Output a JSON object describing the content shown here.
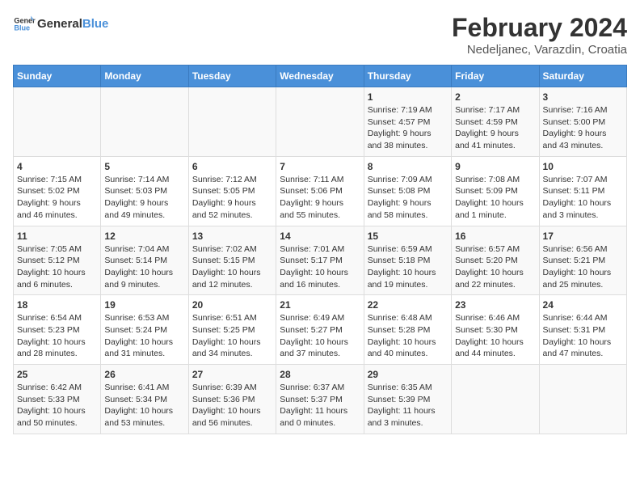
{
  "header": {
    "logo_line1": "General",
    "logo_line2": "Blue",
    "main_title": "February 2024",
    "subtitle": "Nedeljanec, Varazdin, Croatia"
  },
  "weekdays": [
    "Sunday",
    "Monday",
    "Tuesday",
    "Wednesday",
    "Thursday",
    "Friday",
    "Saturday"
  ],
  "weeks": [
    [
      {
        "day": "",
        "info": ""
      },
      {
        "day": "",
        "info": ""
      },
      {
        "day": "",
        "info": ""
      },
      {
        "day": "",
        "info": ""
      },
      {
        "day": "1",
        "info": "Sunrise: 7:19 AM\nSunset: 4:57 PM\nDaylight: 9 hours\nand 38 minutes."
      },
      {
        "day": "2",
        "info": "Sunrise: 7:17 AM\nSunset: 4:59 PM\nDaylight: 9 hours\nand 41 minutes."
      },
      {
        "day": "3",
        "info": "Sunrise: 7:16 AM\nSunset: 5:00 PM\nDaylight: 9 hours\nand 43 minutes."
      }
    ],
    [
      {
        "day": "4",
        "info": "Sunrise: 7:15 AM\nSunset: 5:02 PM\nDaylight: 9 hours\nand 46 minutes."
      },
      {
        "day": "5",
        "info": "Sunrise: 7:14 AM\nSunset: 5:03 PM\nDaylight: 9 hours\nand 49 minutes."
      },
      {
        "day": "6",
        "info": "Sunrise: 7:12 AM\nSunset: 5:05 PM\nDaylight: 9 hours\nand 52 minutes."
      },
      {
        "day": "7",
        "info": "Sunrise: 7:11 AM\nSunset: 5:06 PM\nDaylight: 9 hours\nand 55 minutes."
      },
      {
        "day": "8",
        "info": "Sunrise: 7:09 AM\nSunset: 5:08 PM\nDaylight: 9 hours\nand 58 minutes."
      },
      {
        "day": "9",
        "info": "Sunrise: 7:08 AM\nSunset: 5:09 PM\nDaylight: 10 hours\nand 1 minute."
      },
      {
        "day": "10",
        "info": "Sunrise: 7:07 AM\nSunset: 5:11 PM\nDaylight: 10 hours\nand 3 minutes."
      }
    ],
    [
      {
        "day": "11",
        "info": "Sunrise: 7:05 AM\nSunset: 5:12 PM\nDaylight: 10 hours\nand 6 minutes."
      },
      {
        "day": "12",
        "info": "Sunrise: 7:04 AM\nSunset: 5:14 PM\nDaylight: 10 hours\nand 9 minutes."
      },
      {
        "day": "13",
        "info": "Sunrise: 7:02 AM\nSunset: 5:15 PM\nDaylight: 10 hours\nand 12 minutes."
      },
      {
        "day": "14",
        "info": "Sunrise: 7:01 AM\nSunset: 5:17 PM\nDaylight: 10 hours\nand 16 minutes."
      },
      {
        "day": "15",
        "info": "Sunrise: 6:59 AM\nSunset: 5:18 PM\nDaylight: 10 hours\nand 19 minutes."
      },
      {
        "day": "16",
        "info": "Sunrise: 6:57 AM\nSunset: 5:20 PM\nDaylight: 10 hours\nand 22 minutes."
      },
      {
        "day": "17",
        "info": "Sunrise: 6:56 AM\nSunset: 5:21 PM\nDaylight: 10 hours\nand 25 minutes."
      }
    ],
    [
      {
        "day": "18",
        "info": "Sunrise: 6:54 AM\nSunset: 5:23 PM\nDaylight: 10 hours\nand 28 minutes."
      },
      {
        "day": "19",
        "info": "Sunrise: 6:53 AM\nSunset: 5:24 PM\nDaylight: 10 hours\nand 31 minutes."
      },
      {
        "day": "20",
        "info": "Sunrise: 6:51 AM\nSunset: 5:25 PM\nDaylight: 10 hours\nand 34 minutes."
      },
      {
        "day": "21",
        "info": "Sunrise: 6:49 AM\nSunset: 5:27 PM\nDaylight: 10 hours\nand 37 minutes."
      },
      {
        "day": "22",
        "info": "Sunrise: 6:48 AM\nSunset: 5:28 PM\nDaylight: 10 hours\nand 40 minutes."
      },
      {
        "day": "23",
        "info": "Sunrise: 6:46 AM\nSunset: 5:30 PM\nDaylight: 10 hours\nand 44 minutes."
      },
      {
        "day": "24",
        "info": "Sunrise: 6:44 AM\nSunset: 5:31 PM\nDaylight: 10 hours\nand 47 minutes."
      }
    ],
    [
      {
        "day": "25",
        "info": "Sunrise: 6:42 AM\nSunset: 5:33 PM\nDaylight: 10 hours\nand 50 minutes."
      },
      {
        "day": "26",
        "info": "Sunrise: 6:41 AM\nSunset: 5:34 PM\nDaylight: 10 hours\nand 53 minutes."
      },
      {
        "day": "27",
        "info": "Sunrise: 6:39 AM\nSunset: 5:36 PM\nDaylight: 10 hours\nand 56 minutes."
      },
      {
        "day": "28",
        "info": "Sunrise: 6:37 AM\nSunset: 5:37 PM\nDaylight: 11 hours\nand 0 minutes."
      },
      {
        "day": "29",
        "info": "Sunrise: 6:35 AM\nSunset: 5:39 PM\nDaylight: 11 hours\nand 3 minutes."
      },
      {
        "day": "",
        "info": ""
      },
      {
        "day": "",
        "info": ""
      }
    ]
  ]
}
